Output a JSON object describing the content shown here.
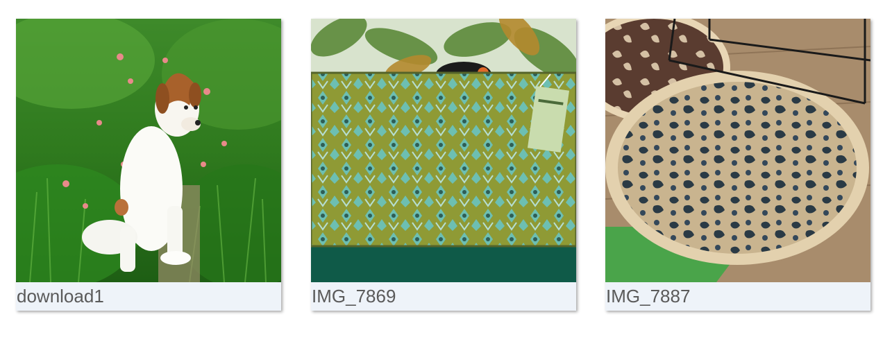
{
  "gallery": {
    "items": [
      {
        "name": "download1",
        "image": "puppy sitting in green grass"
      },
      {
        "name": "IMG_7869",
        "image": "green patterned cushion with leaf wallpaper and price tag"
      },
      {
        "name": "IMG_7887",
        "image": "round leopard-print jute rug on wooden floor"
      }
    ]
  }
}
